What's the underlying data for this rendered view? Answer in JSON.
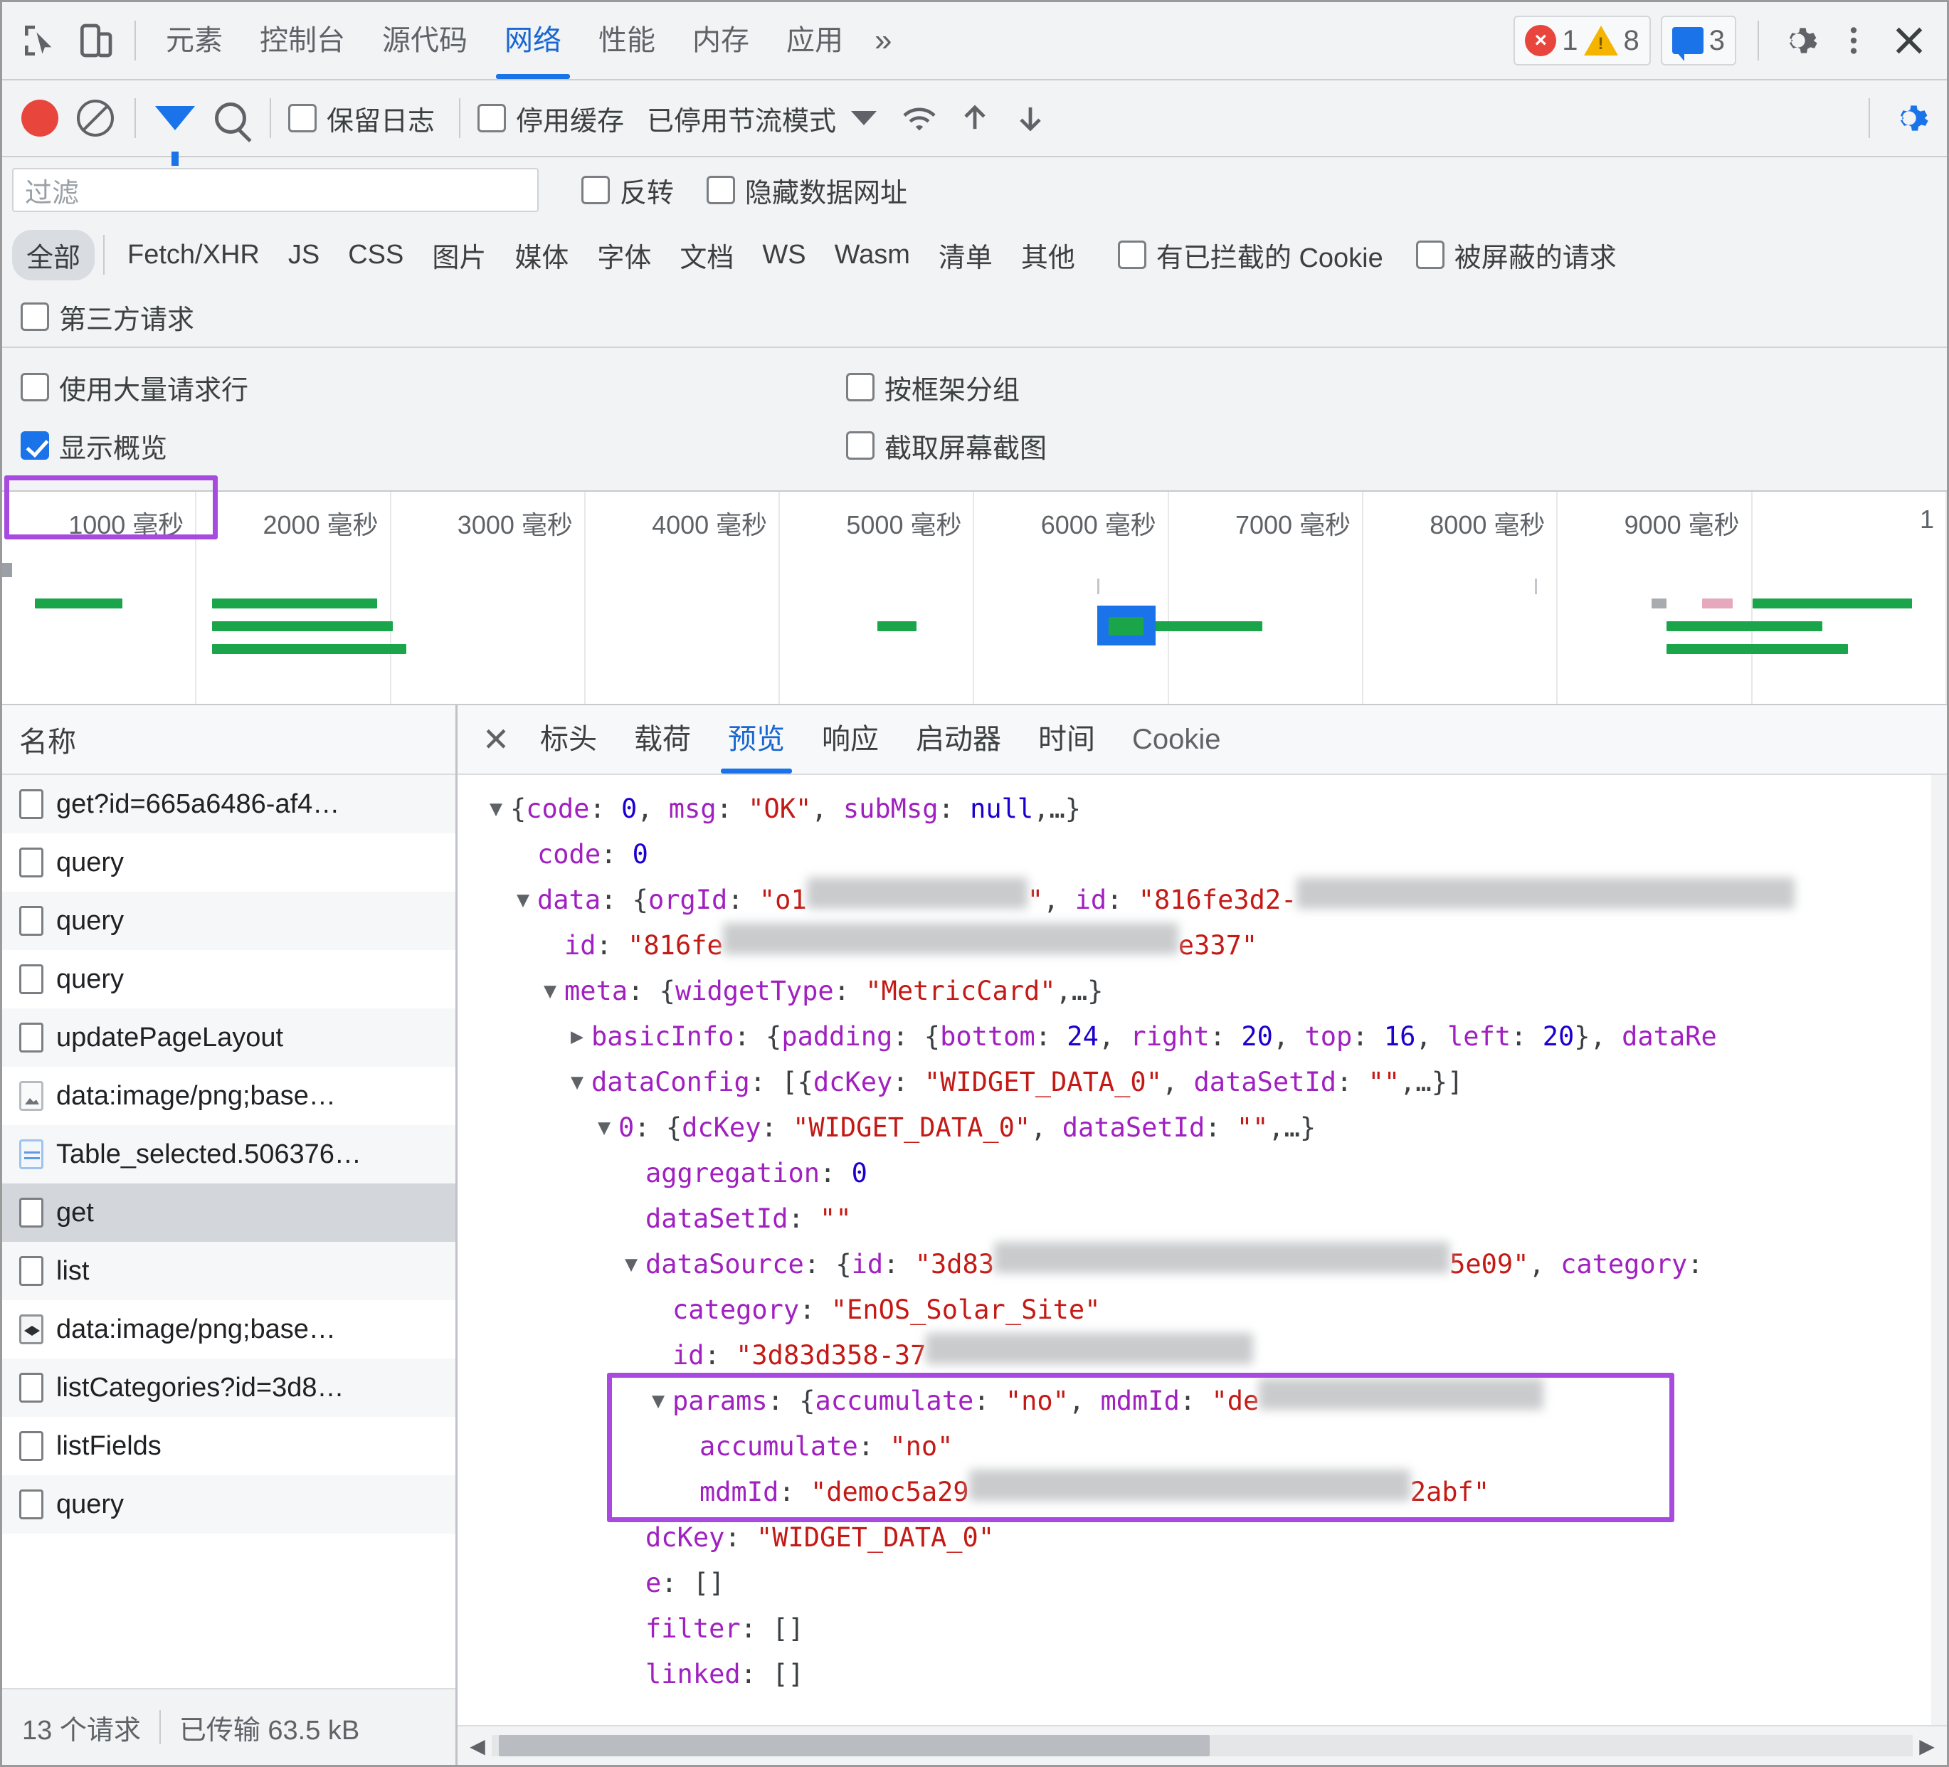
{
  "main_tabs": [
    {
      "label": "元素",
      "selected": false
    },
    {
      "label": "控制台",
      "selected": false
    },
    {
      "label": "源代码",
      "selected": false
    },
    {
      "label": "网络",
      "selected": true
    },
    {
      "label": "性能",
      "selected": false
    },
    {
      "label": "内存",
      "selected": false
    },
    {
      "label": "应用",
      "selected": false
    }
  ],
  "main_tabs_more": "»",
  "counters": {
    "errors": "1",
    "warnings": "8",
    "messages": "3"
  },
  "network_toolbar": {
    "preserve_log": "保留日志",
    "disable_cache": "停用缓存",
    "throttling": "已停用节流模式"
  },
  "filter": {
    "placeholder": "过滤",
    "invert": "反转",
    "hide_data_urls": "隐藏数据网址"
  },
  "type_filters": [
    {
      "label": "全部",
      "selected": true
    },
    {
      "label": "Fetch/XHR",
      "selected": false
    },
    {
      "label": "JS",
      "selected": false
    },
    {
      "label": "CSS",
      "selected": false
    },
    {
      "label": "图片",
      "selected": false
    },
    {
      "label": "媒体",
      "selected": false
    },
    {
      "label": "字体",
      "selected": false
    },
    {
      "label": "文档",
      "selected": false
    },
    {
      "label": "WS",
      "selected": false
    },
    {
      "label": "Wasm",
      "selected": false
    },
    {
      "label": "清单",
      "selected": false
    },
    {
      "label": "其他",
      "selected": false
    }
  ],
  "type_checkboxes": {
    "blocked_cookies": "有已拦截的 Cookie",
    "blocked_requests": "被屏蔽的请求",
    "third_party": "第三方请求"
  },
  "settings": {
    "big_request_rows": {
      "label": "使用大量请求行",
      "checked": false
    },
    "group_by_frame": {
      "label": "按框架分组",
      "checked": false
    },
    "show_overview": {
      "label": "显示概览",
      "checked": true
    },
    "capture_screenshots": {
      "label": "截取屏幕截图",
      "checked": false
    }
  },
  "chart_data": {
    "type": "timeline",
    "title": "Network overview timeline",
    "xlabel": "",
    "unit": "毫秒",
    "xlim": [
      0,
      10000
    ],
    "ticks": [
      "1000 毫秒",
      "2000 毫秒",
      "3000 毫秒",
      "4000 毫秒",
      "5000 毫秒",
      "6000 毫秒",
      "7000 毫秒",
      "8000 毫秒",
      "9000 毫秒",
      "1"
    ],
    "grid": true,
    "bars": [
      {
        "start": 170,
        "end": 620,
        "row": 0,
        "color": "#1aa54b"
      },
      {
        "start": 1080,
        "end": 1930,
        "row": 0,
        "color": "#1aa54b"
      },
      {
        "start": 1080,
        "end": 2010,
        "row": 1,
        "color": "#1aa54b"
      },
      {
        "start": 1080,
        "end": 2080,
        "row": 2,
        "color": "#1aa54b"
      },
      {
        "start": 4500,
        "end": 4700,
        "row": 1,
        "color": "#1aa54b"
      },
      {
        "start": 5630,
        "end": 6480,
        "row": 1,
        "color": "#1aa54b"
      },
      {
        "start": 8560,
        "end": 9360,
        "row": 1,
        "color": "#1aa54b"
      },
      {
        "start": 8560,
        "end": 9490,
        "row": 2,
        "color": "#1aa54b"
      },
      {
        "start": 9000,
        "end": 9820,
        "row": 0,
        "color": "#1aa54b"
      }
    ],
    "selection": {
      "start": 5630,
      "end": 5930,
      "label": "selected-request-marker",
      "color": "#1a73e8"
    }
  },
  "request_list": {
    "column_header": "名称",
    "rows": [
      {
        "name": "get?id=665a6486-af4…",
        "icon": "document-icon",
        "selected": false
      },
      {
        "name": "query",
        "icon": "document-icon",
        "selected": false
      },
      {
        "name": "query",
        "icon": "document-icon",
        "selected": false
      },
      {
        "name": "query",
        "icon": "document-icon",
        "selected": false
      },
      {
        "name": "updatePageLayout",
        "icon": "document-icon",
        "selected": false
      },
      {
        "name": "data:image/png;base…",
        "icon": "image-icon",
        "selected": false
      },
      {
        "name": "Table_selected.506376…",
        "icon": "table-image-icon",
        "selected": false
      },
      {
        "name": "get",
        "icon": "document-icon",
        "selected": true
      },
      {
        "name": "list",
        "icon": "document-icon",
        "selected": false
      },
      {
        "name": "data:image/png;base…",
        "icon": "dark-image-icon",
        "selected": false
      },
      {
        "name": "listCategories?id=3d8…",
        "icon": "document-icon",
        "selected": false
      },
      {
        "name": "listFields",
        "icon": "document-icon",
        "selected": false
      },
      {
        "name": "query",
        "icon": "document-icon",
        "selected": false
      }
    ],
    "footer": {
      "requests": "13 个请求",
      "transferred": "已传输 63.5 kB"
    }
  },
  "detail_tabs": [
    {
      "label": "标头",
      "selected": false
    },
    {
      "label": "载荷",
      "selected": false
    },
    {
      "label": "预览",
      "selected": true
    },
    {
      "label": "响应",
      "selected": false
    },
    {
      "label": "启动器",
      "selected": false
    },
    {
      "label": "时间",
      "selected": false
    },
    {
      "label": "Cookie",
      "selected": false
    }
  ],
  "preview_json": [
    {
      "indent": 0,
      "tri": "▼",
      "parts": [
        {
          "t": "{",
          "c": "p"
        },
        {
          "t": "code",
          "c": "k"
        },
        {
          "t": ": ",
          "c": "p"
        },
        {
          "t": "0",
          "c": "n"
        },
        {
          "t": ", ",
          "c": "p"
        },
        {
          "t": "msg",
          "c": "k"
        },
        {
          "t": ": ",
          "c": "p"
        },
        {
          "t": "\"OK\"",
          "c": "s"
        },
        {
          "t": ", ",
          "c": "p"
        },
        {
          "t": "subMsg",
          "c": "k"
        },
        {
          "t": ": ",
          "c": "p"
        },
        {
          "t": "null",
          "c": "n"
        },
        {
          "t": ",…}",
          "c": "p"
        }
      ]
    },
    {
      "indent": 1,
      "tri": "",
      "parts": [
        {
          "t": "code",
          "c": "k"
        },
        {
          "t": ": ",
          "c": "p"
        },
        {
          "t": "0",
          "c": "n"
        }
      ]
    },
    {
      "indent": 1,
      "tri": "▼",
      "parts": [
        {
          "t": "data",
          "c": "k"
        },
        {
          "t": ": {",
          "c": "p"
        },
        {
          "t": "orgId",
          "c": "k"
        },
        {
          "t": ": ",
          "c": "p"
        },
        {
          "t": "\"o1",
          "c": "s"
        },
        {
          "t": "##310##",
          "c": "blur"
        },
        {
          "t": "\"",
          "c": "s"
        },
        {
          "t": ", ",
          "c": "p"
        },
        {
          "t": "id",
          "c": "k"
        },
        {
          "t": ": ",
          "c": "p"
        },
        {
          "t": "\"816fe3d2-",
          "c": "s"
        },
        {
          "t": "##700##",
          "c": "blur"
        }
      ]
    },
    {
      "indent": 2,
      "tri": "",
      "parts": [
        {
          "t": "id",
          "c": "k"
        },
        {
          "t": ": ",
          "c": "p"
        },
        {
          "t": "\"816fe",
          "c": "s"
        },
        {
          "t": "##640##",
          "c": "blur"
        },
        {
          "t": "e337\"",
          "c": "s"
        }
      ]
    },
    {
      "indent": 2,
      "tri": "▼",
      "parts": [
        {
          "t": "meta",
          "c": "k"
        },
        {
          "t": ": {",
          "c": "p"
        },
        {
          "t": "widgetType",
          "c": "k"
        },
        {
          "t": ": ",
          "c": "p"
        },
        {
          "t": "\"MetricCard\"",
          "c": "s"
        },
        {
          "t": ",…}",
          "c": "p"
        }
      ]
    },
    {
      "indent": 3,
      "tri": "▶",
      "parts": [
        {
          "t": "basicInfo",
          "c": "k"
        },
        {
          "t": ": {",
          "c": "p"
        },
        {
          "t": "padding",
          "c": "k"
        },
        {
          "t": ": {",
          "c": "p"
        },
        {
          "t": "bottom",
          "c": "k"
        },
        {
          "t": ": ",
          "c": "p"
        },
        {
          "t": "24",
          "c": "n"
        },
        {
          "t": ", ",
          "c": "p"
        },
        {
          "t": "right",
          "c": "k"
        },
        {
          "t": ": ",
          "c": "p"
        },
        {
          "t": "20",
          "c": "n"
        },
        {
          "t": ", ",
          "c": "p"
        },
        {
          "t": "top",
          "c": "k"
        },
        {
          "t": ": ",
          "c": "p"
        },
        {
          "t": "16",
          "c": "n"
        },
        {
          "t": ", ",
          "c": "p"
        },
        {
          "t": "left",
          "c": "k"
        },
        {
          "t": ": ",
          "c": "p"
        },
        {
          "t": "20",
          "c": "n"
        },
        {
          "t": "}, ",
          "c": "p"
        },
        {
          "t": "dataRe",
          "c": "k"
        }
      ]
    },
    {
      "indent": 3,
      "tri": "▼",
      "parts": [
        {
          "t": "dataConfig",
          "c": "k"
        },
        {
          "t": ": [{",
          "c": "p"
        },
        {
          "t": "dcKey",
          "c": "k"
        },
        {
          "t": ": ",
          "c": "p"
        },
        {
          "t": "\"WIDGET_DATA_0\"",
          "c": "s"
        },
        {
          "t": ", ",
          "c": "p"
        },
        {
          "t": "dataSetId",
          "c": "k"
        },
        {
          "t": ": ",
          "c": "p"
        },
        {
          "t": "\"\"",
          "c": "s"
        },
        {
          "t": ",…}]",
          "c": "p"
        }
      ]
    },
    {
      "indent": 4,
      "tri": "▼",
      "parts": [
        {
          "t": "0",
          "c": "k"
        },
        {
          "t": ": {",
          "c": "p"
        },
        {
          "t": "dcKey",
          "c": "k"
        },
        {
          "t": ": ",
          "c": "p"
        },
        {
          "t": "\"WIDGET_DATA_0\"",
          "c": "s"
        },
        {
          "t": ", ",
          "c": "p"
        },
        {
          "t": "dataSetId",
          "c": "k"
        },
        {
          "t": ": ",
          "c": "p"
        },
        {
          "t": "\"\"",
          "c": "s"
        },
        {
          "t": ",…}",
          "c": "p"
        }
      ]
    },
    {
      "indent": 5,
      "tri": "",
      "parts": [
        {
          "t": "aggregation",
          "c": "k"
        },
        {
          "t": ": ",
          "c": "p"
        },
        {
          "t": "0",
          "c": "n"
        }
      ]
    },
    {
      "indent": 5,
      "tri": "",
      "parts": [
        {
          "t": "dataSetId",
          "c": "k"
        },
        {
          "t": ": ",
          "c": "p"
        },
        {
          "t": "\"\"",
          "c": "s"
        }
      ]
    },
    {
      "indent": 5,
      "tri": "▼",
      "parts": [
        {
          "t": "dataSource",
          "c": "k"
        },
        {
          "t": ": {",
          "c": "p"
        },
        {
          "t": "id",
          "c": "k"
        },
        {
          "t": ": ",
          "c": "p"
        },
        {
          "t": "\"3d83",
          "c": "s"
        },
        {
          "t": "##640##",
          "c": "blur"
        },
        {
          "t": "5e09\"",
          "c": "s"
        },
        {
          "t": ", ",
          "c": "p"
        },
        {
          "t": "category",
          "c": "k"
        },
        {
          "t": ":",
          "c": "p"
        }
      ]
    },
    {
      "indent": 6,
      "tri": "",
      "parts": [
        {
          "t": "category",
          "c": "k"
        },
        {
          "t": ": ",
          "c": "p"
        },
        {
          "t": "\"EnOS_Solar_Site\"",
          "c": "s"
        }
      ]
    },
    {
      "indent": 6,
      "tri": "",
      "parts": [
        {
          "t": "id",
          "c": "k"
        },
        {
          "t": ": ",
          "c": "p"
        },
        {
          "t": "\"3d83d358-37",
          "c": "s"
        },
        {
          "t": "##460##",
          "c": "blur"
        }
      ]
    },
    {
      "indent": 6,
      "tri": "▼",
      "parts": [
        {
          "t": "params",
          "c": "k"
        },
        {
          "t": ": {",
          "c": "p"
        },
        {
          "t": "accumulate",
          "c": "k"
        },
        {
          "t": ": ",
          "c": "p"
        },
        {
          "t": "\"no\"",
          "c": "s"
        },
        {
          "t": ", ",
          "c": "p"
        },
        {
          "t": "mdmId",
          "c": "k"
        },
        {
          "t": ": ",
          "c": "p"
        },
        {
          "t": "\"de",
          "c": "s"
        },
        {
          "t": "##400##",
          "c": "blur"
        }
      ]
    },
    {
      "indent": 7,
      "tri": "",
      "parts": [
        {
          "t": "accumulate",
          "c": "k"
        },
        {
          "t": ": ",
          "c": "p"
        },
        {
          "t": "\"no\"",
          "c": "s"
        }
      ]
    },
    {
      "indent": 7,
      "tri": "",
      "parts": [
        {
          "t": "mdmId",
          "c": "k"
        },
        {
          "t": ": ",
          "c": "p"
        },
        {
          "t": "\"democ5a29",
          "c": "s"
        },
        {
          "t": "##620##",
          "c": "blur"
        },
        {
          "t": "2abf\"",
          "c": "s"
        }
      ]
    },
    {
      "indent": 5,
      "tri": "",
      "parts": [
        {
          "t": "dcKey",
          "c": "k"
        },
        {
          "t": ": ",
          "c": "p"
        },
        {
          "t": "\"WIDGET_DATA_0\"",
          "c": "s"
        }
      ]
    },
    {
      "indent": 5,
      "tri": "",
      "parts": [
        {
          "t": "e",
          "c": "k"
        },
        {
          "t": ": []",
          "c": "p"
        }
      ]
    },
    {
      "indent": 5,
      "tri": "",
      "parts": [
        {
          "t": "filter",
          "c": "k"
        },
        {
          "t": ": []",
          "c": "p"
        }
      ]
    },
    {
      "indent": 5,
      "tri": "",
      "parts": [
        {
          "t": "linked",
          "c": "k"
        },
        {
          "t": ": []",
          "c": "p"
        }
      ]
    }
  ],
  "annotations": {
    "highlight_color": "#a64ae0",
    "boxes": [
      "request-get-row",
      "params-block"
    ]
  }
}
